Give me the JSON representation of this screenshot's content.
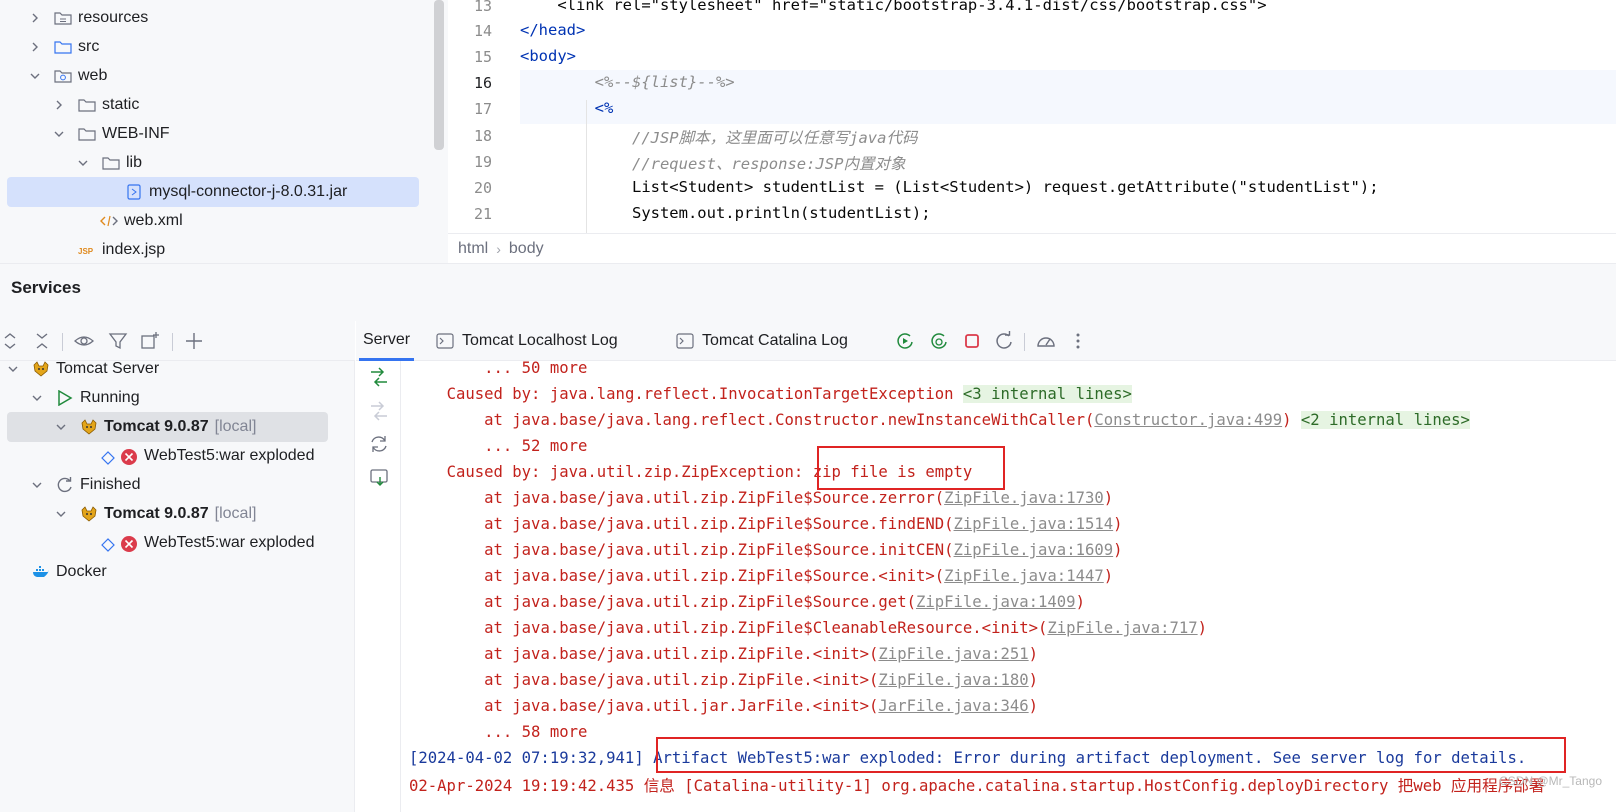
{
  "project_tree": {
    "items": [
      {
        "label": "resources",
        "icon": "resources-folder-icon",
        "depth": 1,
        "expanded": false
      },
      {
        "label": "src",
        "icon": "folder-icon",
        "depth": 1,
        "expanded": false
      },
      {
        "label": "web",
        "icon": "web-folder-icon",
        "depth": 1,
        "expanded": true
      },
      {
        "label": "static",
        "icon": "folder-icon",
        "depth": 2,
        "expanded": false
      },
      {
        "label": "WEB-INF",
        "icon": "folder-icon",
        "depth": 2,
        "expanded": true
      },
      {
        "label": "lib",
        "icon": "folder-icon",
        "depth": 3,
        "expanded": true
      },
      {
        "label": "mysql-connector-j-8.0.31.jar",
        "icon": "jar-icon",
        "depth": 5,
        "selected": true
      },
      {
        "label": "web.xml",
        "icon": "xml-icon",
        "depth": 4
      },
      {
        "label": "index.jsp",
        "icon": "jsp-icon",
        "depth": 3
      }
    ]
  },
  "editor": {
    "lines": [
      {
        "num": "13",
        "text": "    <link rel=\"stylesheet\" href=\"static/bootstrap-3.4.1-dist/css/bootstrap.css\">"
      },
      {
        "num": "14",
        "text": "</head>"
      },
      {
        "num": "15",
        "text": "<body>"
      },
      {
        "num": "16",
        "text": "        <%--${list}--%>"
      },
      {
        "num": "17",
        "text": "        <%"
      },
      {
        "num": "18",
        "text": "            //JSP脚本，这里面可以任意写java代码"
      },
      {
        "num": "19",
        "text": "            //request、response:JSP内置对象"
      },
      {
        "num": "20",
        "text": "            List<Student> studentList = (List<Student>) request.getAttribute(\"studentList\");"
      },
      {
        "num": "21",
        "text": "            System.out.println(studentList);"
      }
    ],
    "current_line": "16",
    "breadcrumb": [
      "html",
      "body"
    ]
  },
  "services": {
    "title": "Services",
    "tree": [
      {
        "label": "Tomcat Server",
        "icon": "tomcat-icon",
        "depth": 0,
        "expanded": true
      },
      {
        "label": "Running",
        "icon": "run-icon",
        "depth": 1,
        "expanded": true
      },
      {
        "label": "Tomcat 9.0.87",
        "suffix": "[local]",
        "icon": "tomcat-icon",
        "depth": 2,
        "expanded": true,
        "selected": true
      },
      {
        "label": "WebTest5:war exploded",
        "icon": "artifact-error-icon",
        "depth": 3
      },
      {
        "label": "Finished",
        "icon": "refresh-icon",
        "depth": 1,
        "expanded": true
      },
      {
        "label": "Tomcat 9.0.87",
        "suffix": "[local]",
        "icon": "tomcat-icon",
        "depth": 2,
        "expanded": true
      },
      {
        "label": "WebTest5:war exploded",
        "icon": "artifact-error-icon",
        "depth": 3
      },
      {
        "label": "Docker",
        "icon": "docker-icon",
        "depth": 0
      }
    ]
  },
  "console_tabs": {
    "server": "Server",
    "localhost_log": "Tomcat Localhost Log",
    "catalina_log": "Tomcat Catalina Log"
  },
  "console": {
    "lines": [
      {
        "indent": "        ",
        "text": "... 50 more"
      },
      {
        "indent": "    ",
        "text": "Caused by: java.lang.reflect.InvocationTargetException ",
        "internal": "<3 internal lines>",
        "fold": true
      },
      {
        "indent": "        ",
        "text": "at java.base/java.lang.reflect.Constructor.newInstanceWithCaller(",
        "link": "Constructor.java:499",
        "after": ") ",
        "internal": "<2 internal lines>",
        "fold": true
      },
      {
        "indent": "        ",
        "text": "... 52 more"
      },
      {
        "indent": "    ",
        "text": "Caused by: java.util.zip.ZipException: ",
        "highlight": "zip file is empty"
      },
      {
        "indent": "        ",
        "text": "at java.base/java.util.zip.ZipFile$Source.zerror(",
        "link": "ZipFile.java:1730",
        "after": ")"
      },
      {
        "indent": "        ",
        "text": "at java.base/java.util.zip.ZipFile$Source.findEND(",
        "link": "ZipFile.java:1514",
        "after": ")"
      },
      {
        "indent": "        ",
        "text": "at java.base/java.util.zip.ZipFile$Source.initCEN(",
        "link": "ZipFile.java:1609",
        "after": ")"
      },
      {
        "indent": "        ",
        "text": "at java.base/java.util.zip.ZipFile$Source.<init>(",
        "link": "ZipFile.java:1447",
        "after": ")"
      },
      {
        "indent": "        ",
        "text": "at java.base/java.util.zip.ZipFile$Source.get(",
        "link": "ZipFile.java:1409",
        "after": ")"
      },
      {
        "indent": "        ",
        "text": "at java.base/java.util.zip.ZipFile$CleanableResource.<init>(",
        "link": "ZipFile.java:717",
        "after": ")"
      },
      {
        "indent": "        ",
        "text": "at java.base/java.util.zip.ZipFile.<init>(",
        "link": "ZipFile.java:251",
        "after": ")"
      },
      {
        "indent": "        ",
        "text": "at java.base/java.util.zip.ZipFile.<init>(",
        "link": "ZipFile.java:180",
        "after": ")"
      },
      {
        "indent": "        ",
        "text": "at java.base/java.util.jar.JarFile.<init>(",
        "link": "JarFile.java:346",
        "after": ")"
      },
      {
        "indent": "        ",
        "text": "... 58 more"
      }
    ],
    "status_timestamp": "[2024-04-02 07:19:32,941]",
    "status_message": "Artifact WebTest5:war exploded: Error during artifact deployment. See server log for details.",
    "cut_line": "02-Apr-2024 19:19:42.435 信息 [Catalina-utility-1] org.apache.catalina.startup.HostConfig.deployDirectory 把web 应用程序部署",
    "watermark": "CSDN @Mr_Tango"
  },
  "colors": {
    "accent": "#3574f0",
    "error_text": "#c2221c",
    "info_text": "#1a3a9c",
    "highlight_box": "#e02424"
  }
}
